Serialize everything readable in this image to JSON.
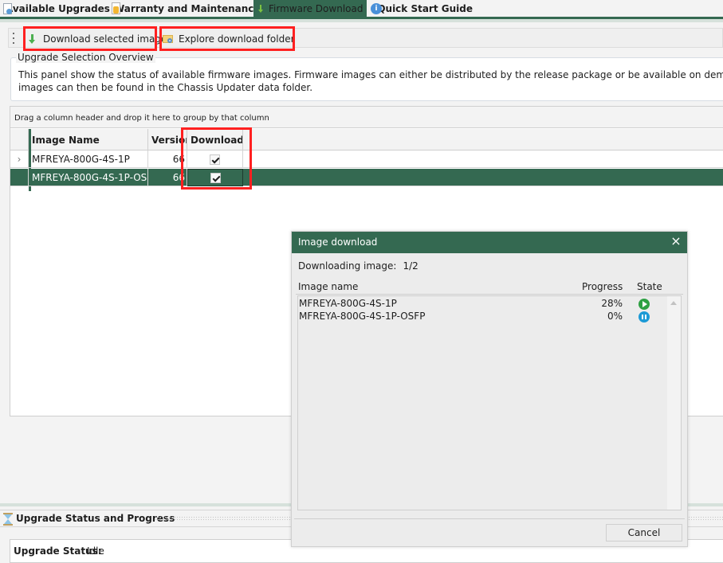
{
  "tabs": [
    {
      "label": "Available Upgrades",
      "icon": "document-search-icon",
      "active": false
    },
    {
      "label": "Warranty and Maintenance",
      "icon": "medal-icon",
      "active": false
    },
    {
      "label": "Firmware Download",
      "icon": "download-arrow-icon",
      "active": true
    },
    {
      "label": "Quick Start Guide",
      "icon": "info-icon",
      "active": false
    }
  ],
  "toolbar": {
    "download_selected_label": "Download selected images",
    "explore_folder_label": "Explore download folder"
  },
  "overview": {
    "title": "Upgrade Selection Overview",
    "line1": "This panel show the status of available firmware images. Firmware images can either be distributed by the release package or be available on demand from Xena Netwo",
    "line2": "images can then be found in the Chassis Updater data folder."
  },
  "grid": {
    "group_hint": "Drag a column header and drop it here to group by that column",
    "columns": [
      "Image Name",
      "Version",
      "Download"
    ],
    "rows": [
      {
        "name": "MFREYA-800G-4S-1P",
        "version": "66",
        "download": true,
        "selected": false,
        "current": true
      },
      {
        "name": "MFREYA-800G-4S-1P-OSFP",
        "version": "66",
        "download": true,
        "selected": true,
        "current": false
      }
    ]
  },
  "status_panel": {
    "title": "Upgrade Status and Progress",
    "status_label": "Upgrade Status:",
    "status_value": "Idle"
  },
  "dialog": {
    "title": "Image download",
    "downloading_label": "Downloading image:",
    "downloading_value": "1/2",
    "columns": [
      "Image name",
      "Progress",
      "State"
    ],
    "items": [
      {
        "name": "MFREYA-800G-4S-1P",
        "progress": "28%",
        "state": "running"
      },
      {
        "name": "MFREYA-800G-4S-1P-OSFP",
        "progress": "0%",
        "state": "paused"
      }
    ],
    "cancel_label": "Cancel",
    "close_icon": "×"
  },
  "colors": {
    "accent": "#346951",
    "highlight": "#ff2020",
    "running": "#2ea043",
    "paused": "#1c9ad6"
  }
}
